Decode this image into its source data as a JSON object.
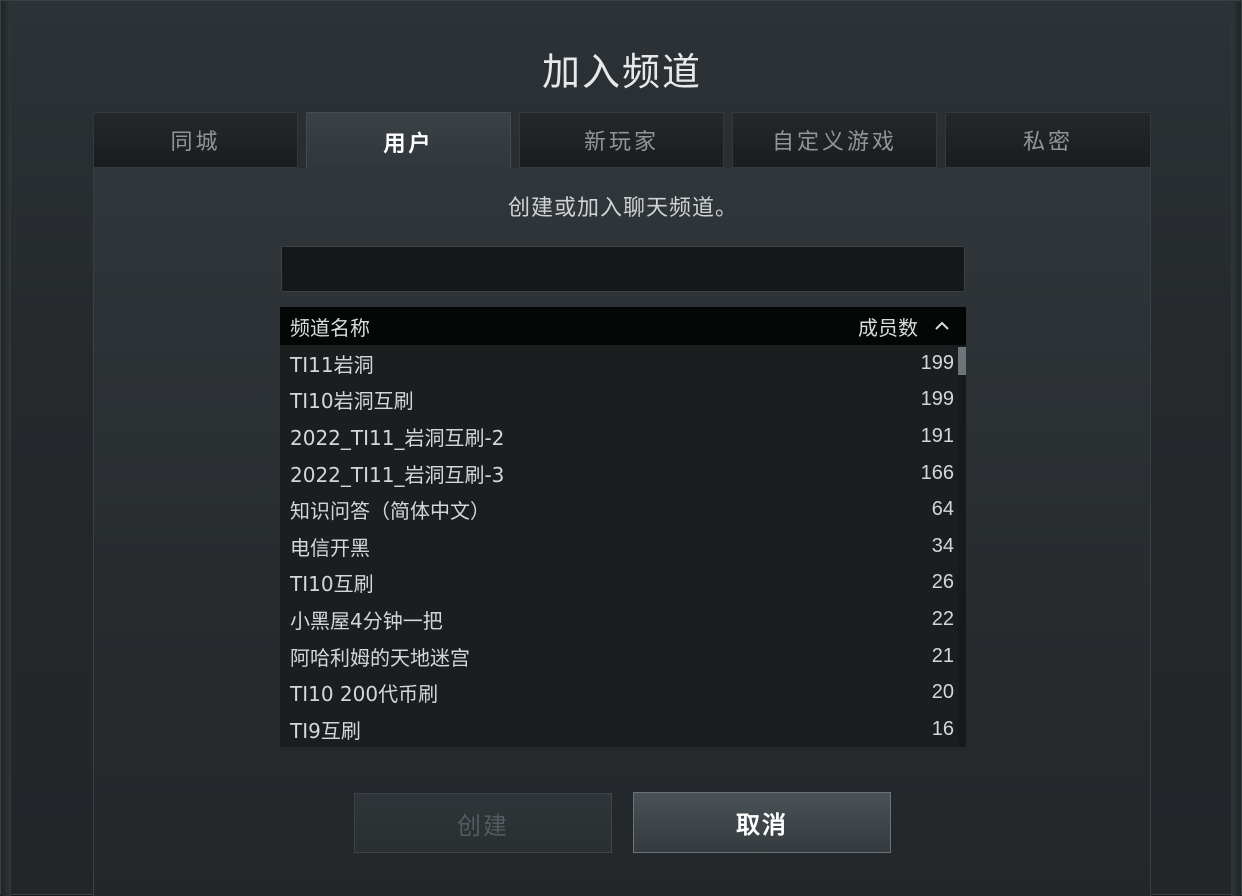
{
  "dialog": {
    "title": "加入频道",
    "subtitle": "创建或加入聊天频道。"
  },
  "tabs": [
    {
      "label": "同城",
      "active": false
    },
    {
      "label": "用户",
      "active": true
    },
    {
      "label": "新玩家",
      "active": false
    },
    {
      "label": "自定义游戏",
      "active": false
    },
    {
      "label": "私密",
      "active": false
    }
  ],
  "search": {
    "value": "",
    "placeholder": ""
  },
  "list": {
    "headers": {
      "name": "频道名称",
      "count": "成员数"
    },
    "sort_icon": "chevron-up-icon",
    "rows": [
      {
        "name": "TI11岩洞",
        "count": "199"
      },
      {
        "name": "TI10岩洞互刷",
        "count": "199"
      },
      {
        "name": "2022_TI11_岩洞互刷-2",
        "count": "191"
      },
      {
        "name": "2022_TI11_岩洞互刷-3",
        "count": "166"
      },
      {
        "name": "知识问答（简体中文）",
        "count": "64"
      },
      {
        "name": "电信开黑",
        "count": "34"
      },
      {
        "name": "TI10互刷",
        "count": "26"
      },
      {
        "name": "小黑屋4分钟一把",
        "count": "22"
      },
      {
        "name": "阿哈利姆的天地迷宫",
        "count": "21"
      },
      {
        "name": "TI10 200代币刷",
        "count": "20"
      },
      {
        "name": "TI9互刷",
        "count": "16"
      }
    ]
  },
  "buttons": {
    "create": "创建",
    "cancel": "取消"
  },
  "colors": {
    "background": "#272b2e",
    "header": "#050606",
    "active_tab": "#3b4246",
    "text": "#d4d7d8"
  }
}
